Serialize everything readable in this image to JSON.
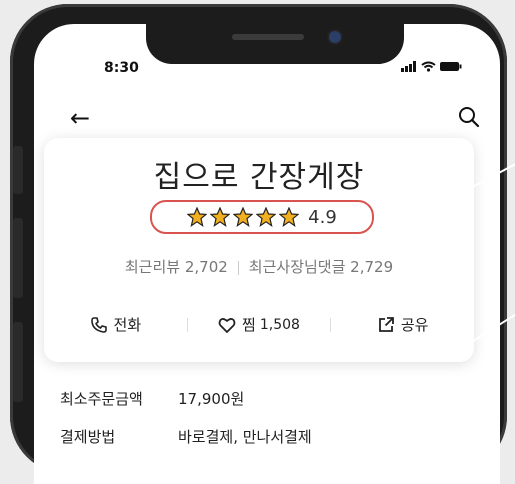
{
  "status_bar": {
    "time": "8:30"
  },
  "store": {
    "name": "집으로 간장게장",
    "rating": "4.9",
    "review_count_label": "최근리뷰 2,702",
    "owner_reply_label": "최근사장님댓글 2,729",
    "stars": 5
  },
  "actions": {
    "call": "전화",
    "favorite": "찜",
    "favorite_count": "1,508",
    "share": "공유"
  },
  "info": [
    {
      "key": "최소주문금액",
      "value": "17,900원"
    },
    {
      "key": "결제방법",
      "value": "바로결제, 만나서결제"
    }
  ],
  "colors": {
    "star": "#f2b01e",
    "highlight": "#d9534f"
  }
}
